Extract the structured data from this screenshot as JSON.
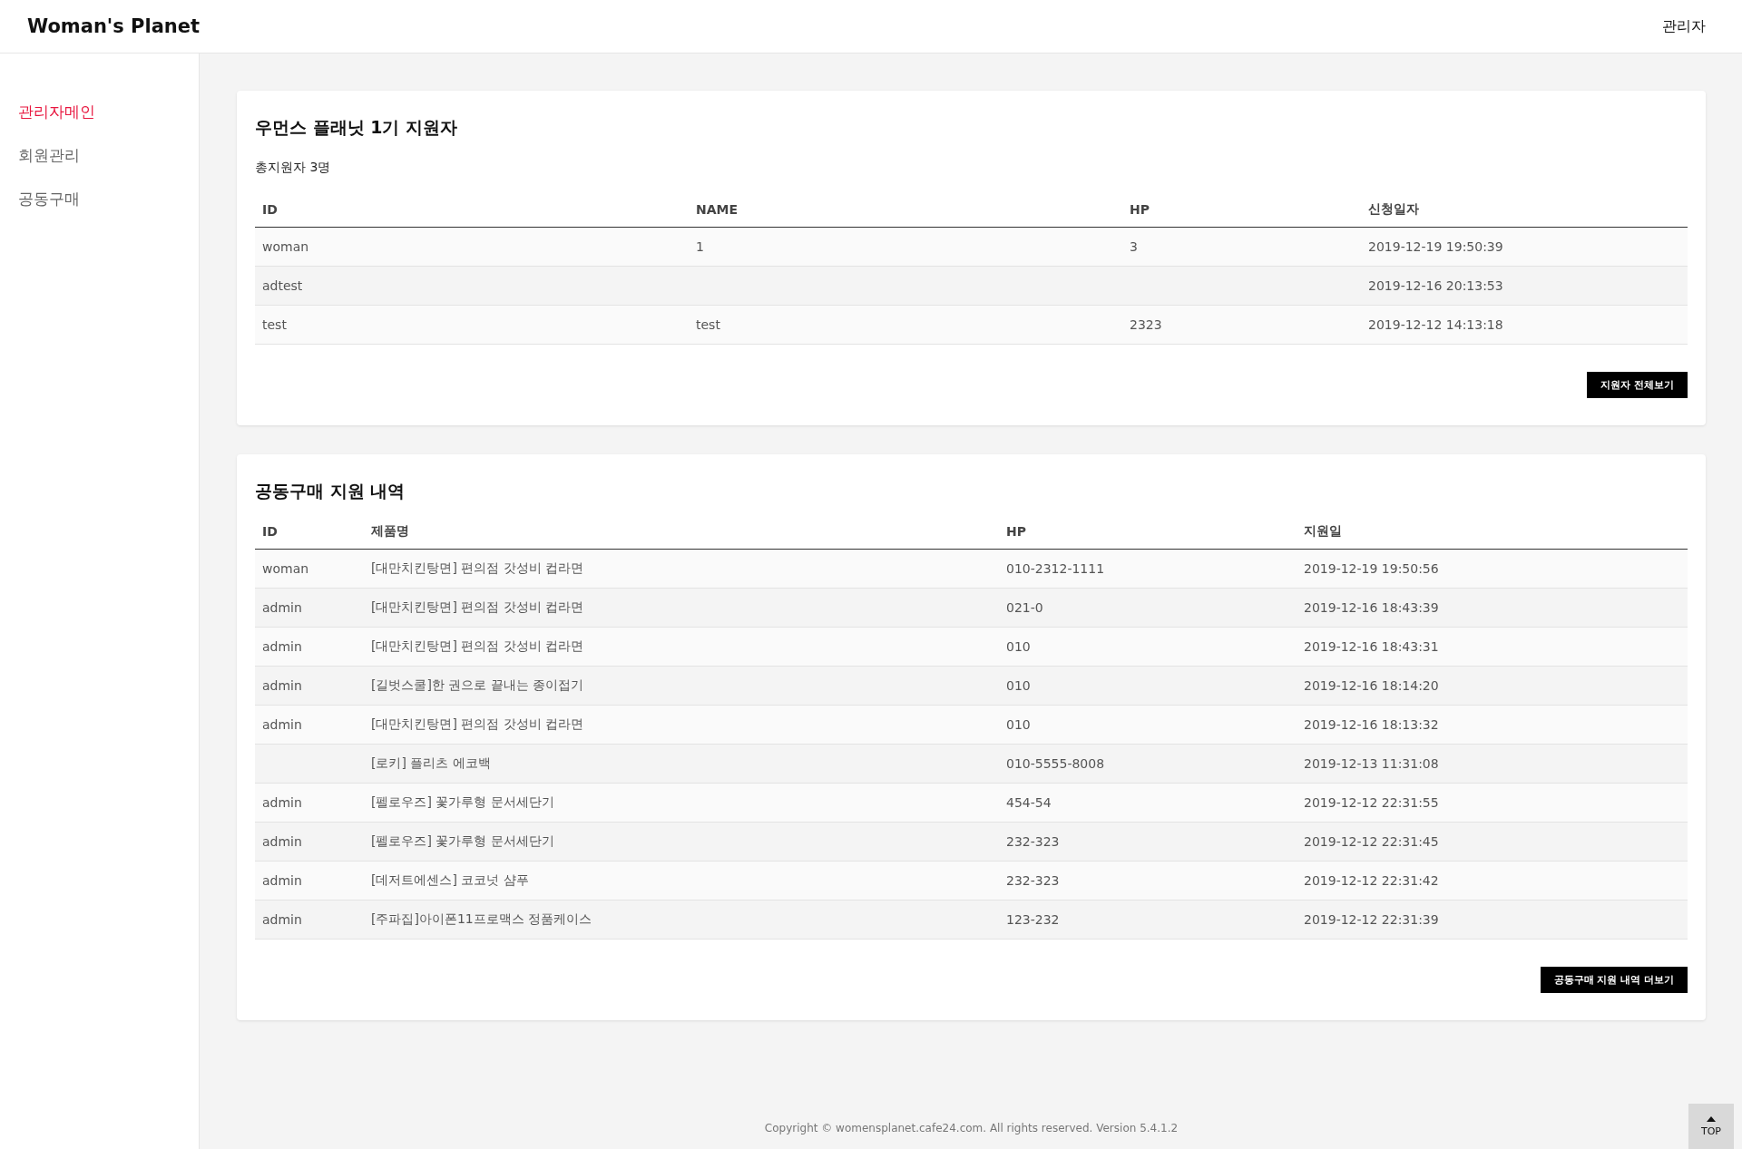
{
  "header": {
    "logo": "Woman's Planet",
    "user": "관리자"
  },
  "sidebar": {
    "items": [
      {
        "label": "관리자메인",
        "selected": true
      },
      {
        "label": "회원관리",
        "selected": false
      },
      {
        "label": "공동구매",
        "selected": false
      }
    ]
  },
  "applicants": {
    "title": "우먼스 플래닛 1기 지원자",
    "total": "총지원자 3명",
    "columns": [
      "ID",
      "NAME",
      "HP",
      "신청일자"
    ],
    "rows": [
      {
        "id": "woman",
        "name": "1",
        "hp": "3",
        "date": "2019-12-19 19:50:39"
      },
      {
        "id": "adtest",
        "date": "2019-12-16 20:13:53"
      },
      {
        "id": "test",
        "name": "test",
        "hp": "2323",
        "date": "2019-12-12 14:13:18"
      }
    ],
    "button": "지원자 전체보기"
  },
  "group_buy": {
    "title": "공동구매 지원 내역",
    "columns": [
      "ID",
      "제품명",
      "HP",
      "지원일"
    ],
    "rows": [
      {
        "id": "woman",
        "product": "[대만치킨탕면] 편의점 갓성비 컵라면",
        "hp": "010-2312-1111",
        "date": "2019-12-19 19:50:56"
      },
      {
        "id": "admin",
        "product": "[대만치킨탕면] 편의점 갓성비 컵라면",
        "hp": "021-0",
        "date": "2019-12-16 18:43:39"
      },
      {
        "id": "admin",
        "product": "[대만치킨탕면] 편의점 갓성비 컵라면",
        "hp": "010",
        "date": "2019-12-16 18:43:31"
      },
      {
        "id": "admin",
        "product": "[길벗스쿨]한 권으로 끝내는 종이접기",
        "hp": "010",
        "date": "2019-12-16 18:14:20"
      },
      {
        "id": "admin",
        "product": "[대만치킨탕면] 편의점 갓성비 컵라면",
        "hp": "010",
        "date": "2019-12-16 18:13:32"
      },
      {
        "product": "[로키] 플리츠 에코백",
        "hp": "010-5555-8008",
        "date": "2019-12-13 11:31:08"
      },
      {
        "id": "admin",
        "product": "[펠로우즈] 꽃가루형 문서세단기",
        "hp": "454-54",
        "date": "2019-12-12 22:31:55"
      },
      {
        "id": "admin",
        "product": "[펠로우즈] 꽃가루형 문서세단기",
        "hp": "232-323",
        "date": "2019-12-12 22:31:45"
      },
      {
        "id": "admin",
        "product": "[데저트에센스] 코코넛 샴푸",
        "hp": "232-323",
        "date": "2019-12-12 22:31:42"
      },
      {
        "id": "admin",
        "product": "[주파집]아이폰11프로맥스 정품케이스",
        "hp": "123-232",
        "date": "2019-12-12 22:31:39"
      }
    ],
    "button": "공동구매 지원 내역 더보기"
  },
  "footer": {
    "copyright": "Copyright © womensplanet.cafe24.com. All rights reserved. Version 5.4.1.2",
    "top_button": "TOP"
  }
}
